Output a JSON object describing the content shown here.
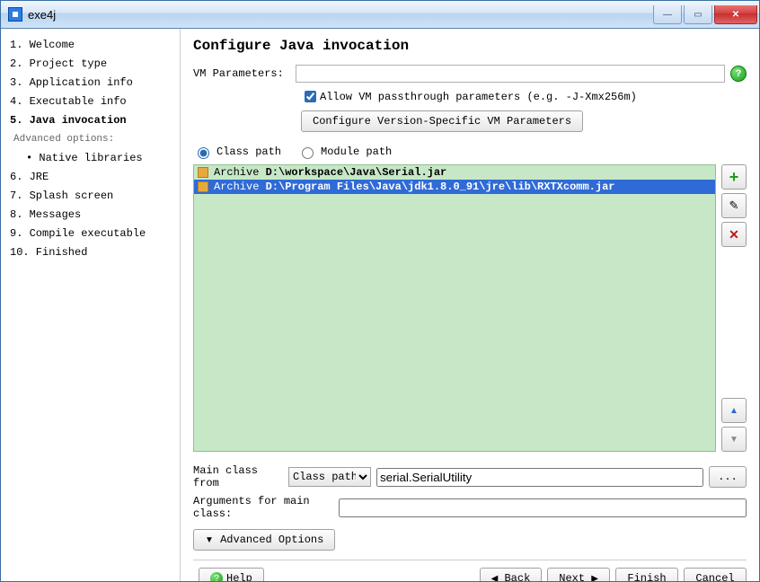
{
  "window": {
    "title": "exe4j"
  },
  "sidebar": {
    "watermark": "exe4j",
    "steps": [
      {
        "label": "1. Welcome"
      },
      {
        "label": "2. Project type"
      },
      {
        "label": "3. Application info"
      },
      {
        "label": "4. Executable info"
      },
      {
        "label": "5. Java invocation",
        "current": true
      },
      {
        "label": "Advanced options:",
        "subheader": true
      },
      {
        "label": "• Native libraries",
        "subitem": true
      },
      {
        "label": "6. JRE"
      },
      {
        "label": "7. Splash screen"
      },
      {
        "label": "8. Messages"
      },
      {
        "label": "9. Compile executable"
      },
      {
        "label": "10. Finished"
      }
    ]
  },
  "main": {
    "heading": "Configure Java invocation",
    "vm_params_label": "VM Parameters:",
    "vm_params_value": "",
    "allow_passthrough_label": "Allow VM passthrough parameters (e.g. -J-Xmx256m)",
    "allow_passthrough_checked": true,
    "config_version_btn": "Configure Version-Specific VM Parameters",
    "radio_classpath": "Class path",
    "radio_modulepath": "Module path",
    "radio_selected": "classpath",
    "classpath": [
      {
        "label_prefix": "Archive ",
        "path": "D:\\workspace\\Java\\Serial.jar",
        "selected": false
      },
      {
        "label_prefix": "Archive ",
        "path": "D:\\Program Files\\Java\\jdk1.8.0_91\\jre\\lib\\RXTXcomm.jar",
        "selected": true
      }
    ],
    "main_class_from_label": "Main class from",
    "main_class_from_options": [
      "Class path"
    ],
    "main_class_value": "serial.SerialUtility",
    "arguments_label": "Arguments for main class:",
    "arguments_value": "",
    "advanced_options_btn": "Advanced Options",
    "browse_btn": "..."
  },
  "footer": {
    "help": "Help",
    "back": "Back",
    "next": "Next",
    "finish": "Finish",
    "cancel": "Cancel"
  }
}
